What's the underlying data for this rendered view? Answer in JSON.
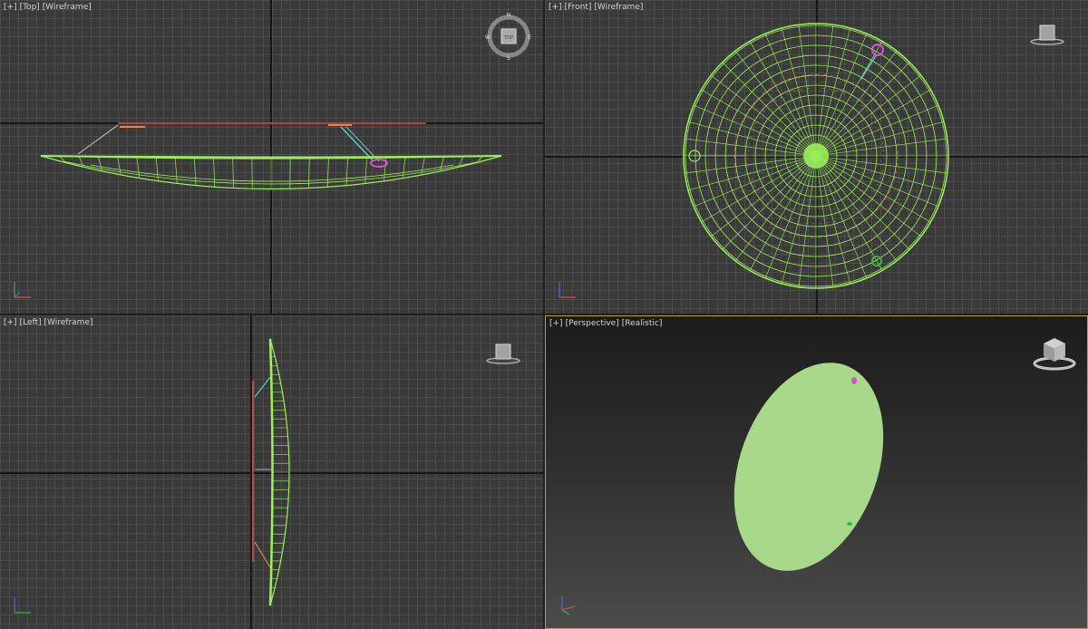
{
  "viewports": {
    "top": {
      "plus": "[+]",
      "view": "[Top]",
      "shading": "[Wireframe]"
    },
    "front": {
      "plus": "[+]",
      "view": "[Front]",
      "shading": "[Wireframe]"
    },
    "left": {
      "plus": "[+]",
      "view": "[Left]",
      "shading": "[Wireframe]"
    },
    "perspective": {
      "plus": "[+]",
      "view": "[Perspective]",
      "shading": "[Realistic]"
    }
  },
  "viewcube": {
    "top_face": "TOP",
    "compass": {
      "n": "N",
      "s": "S",
      "e": "E",
      "w": "W"
    }
  },
  "colors": {
    "mesh": "#9bf05a",
    "mesh_shaded": "#a8d98a",
    "wire_red": "#e0504f",
    "wire_cyan": "#5fc9c2",
    "marker_magenta": "#d94fd1",
    "marker_green": "#3bb24a",
    "active_border": "#b6a23a"
  }
}
